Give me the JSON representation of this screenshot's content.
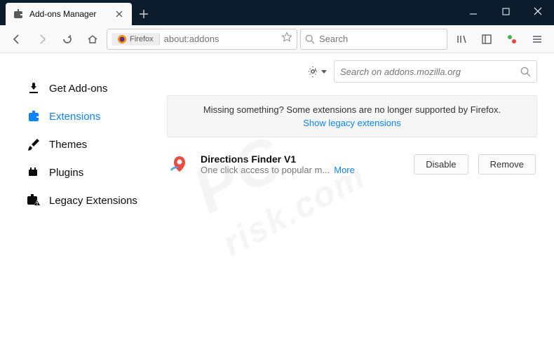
{
  "window": {
    "tab_title": "Add-ons Manager",
    "url": "about:addons",
    "url_chip": "Firefox",
    "search_placeholder": "Search"
  },
  "sidebar": {
    "items": [
      {
        "label": "Get Add-ons"
      },
      {
        "label": "Extensions"
      },
      {
        "label": "Themes"
      },
      {
        "label": "Plugins"
      },
      {
        "label": "Legacy Extensions"
      }
    ]
  },
  "main": {
    "addon_search_placeholder": "Search on addons.mozilla.org",
    "notice_text": "Missing something? Some extensions are no longer supported by Firefox.",
    "notice_link": "Show legacy extensions",
    "addons": [
      {
        "name": "Directions Finder V1",
        "description": "One click access to popular m...",
        "more": "More",
        "disable": "Disable",
        "remove": "Remove"
      }
    ]
  },
  "watermark": {
    "line1": "PC",
    "line2": "risk.com"
  }
}
